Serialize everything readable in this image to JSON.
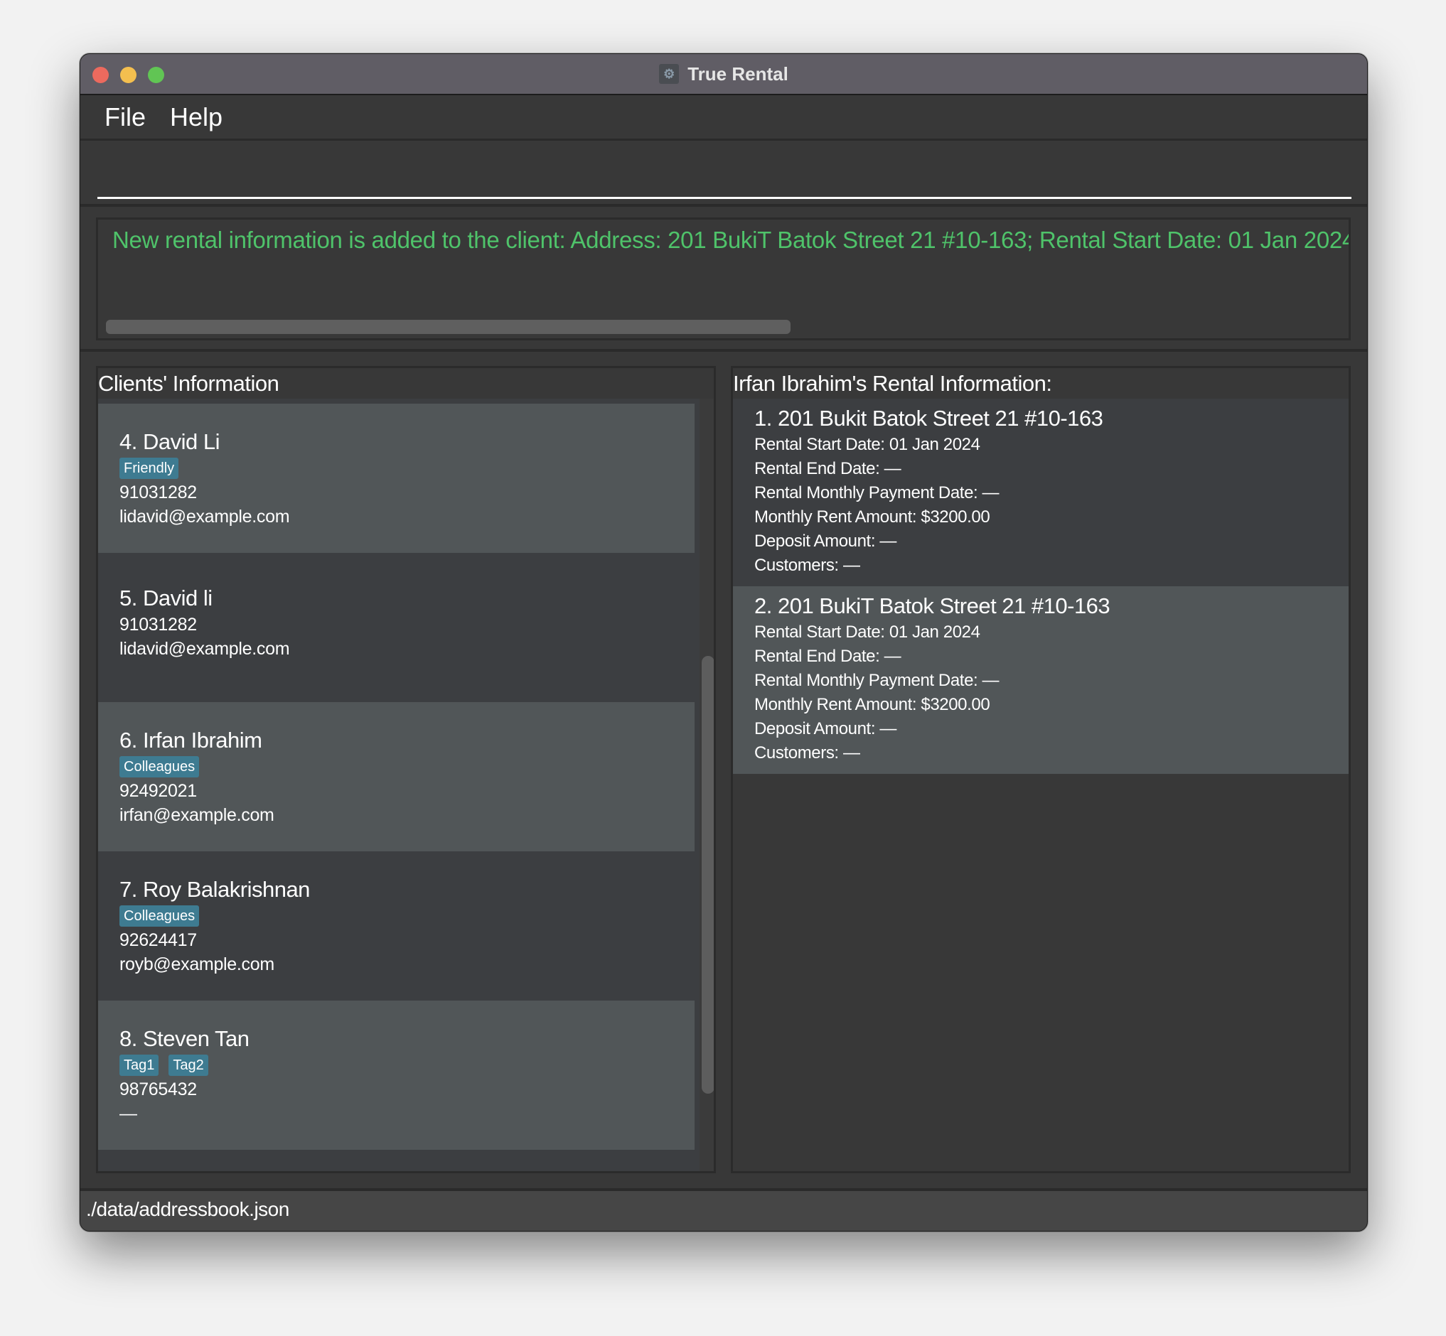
{
  "window": {
    "title": "True Rental",
    "app_icon": "gear-house-icon"
  },
  "menu": {
    "items": [
      {
        "label": "File"
      },
      {
        "label": "Help"
      }
    ]
  },
  "command_box": {
    "value": "",
    "placeholder": ""
  },
  "result_display": {
    "text": "New rental information is added to the client: Address: 201 BukiT Batok Street 21 #10-163; Rental Start Date: 01 Jan 2024",
    "color": "#4fc36a",
    "horizontal_scroll_fraction": 0.55
  },
  "clients_panel": {
    "header": "Clients' Information",
    "clients": [
      {
        "name": "4. David Li",
        "tags": [
          "Friendly"
        ],
        "phone": "91031282",
        "email": "lidavid@example.com"
      },
      {
        "name": "5. David li",
        "tags": [],
        "phone": "91031282",
        "email": "lidavid@example.com"
      },
      {
        "name": "6. Irfan Ibrahim",
        "tags": [
          "Colleagues"
        ],
        "phone": "92492021",
        "email": "irfan@example.com"
      },
      {
        "name": "7. Roy Balakrishnan",
        "tags": [
          "Colleagues"
        ],
        "phone": "92624417",
        "email": "royb@example.com"
      },
      {
        "name": "8. Steven Tan",
        "tags": [
          "Tag1",
          "Tag2"
        ],
        "phone": "98765432",
        "email": "—"
      }
    ],
    "tag_color": "#3e7b91"
  },
  "rental_panel": {
    "header": "Irfan Ibrahim's Rental Information:",
    "rentals": [
      {
        "title": "1. 201 Bukit Batok Street 21 #10-163",
        "start_date": "Rental Start Date: 01 Jan 2024",
        "end_date": "Rental End Date: —",
        "payment_date": "Rental Monthly Payment Date: —",
        "rent_amount": "Monthly Rent Amount: $3200.00",
        "deposit": "Deposit Amount: —",
        "customers": "Customers: —"
      },
      {
        "title": "2. 201 BukiT Batok Street 21 #10-163",
        "start_date": "Rental Start Date: 01 Jan 2024",
        "end_date": "Rental End Date: —",
        "payment_date": "Rental Monthly Payment Date: —",
        "rent_amount": "Monthly Rent Amount: $3200.00",
        "deposit": "Deposit Amount: —",
        "customers": "Customers: —"
      }
    ]
  },
  "status_bar": {
    "file_path": "./data/addressbook.json"
  }
}
